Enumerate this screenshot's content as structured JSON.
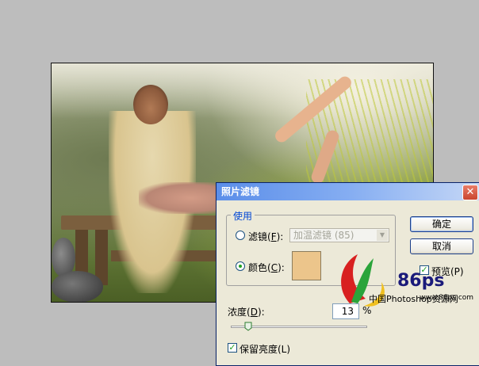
{
  "dialog": {
    "title": "照片滤镜",
    "close_glyph": "✕",
    "group_label": "使用",
    "filter_option": {
      "label": "滤镜(",
      "key": "F",
      "suffix": "):",
      "selected": false
    },
    "filter_select": {
      "value": "加温滤镜 (85)",
      "arrow_glyph": "▼"
    },
    "color_option": {
      "label": "颜色(",
      "key": "C",
      "suffix": "):",
      "selected": true
    },
    "swatch_color": "#ecc58b",
    "ok_label": "确定",
    "cancel_label": "取消",
    "preview": {
      "label": "预览(P)",
      "checked": true
    },
    "density": {
      "label": "浓度(",
      "key": "D",
      "suffix": "):",
      "value": "13",
      "unit": "%",
      "slider_fraction": 0.13
    },
    "preserve": {
      "label": "保留亮度(L)",
      "checked": true
    },
    "check_glyph": "✓"
  },
  "watermark": {
    "brand": "86ps",
    "url": "www.86ps.com",
    "tagline": "中国Photoshop资源网"
  },
  "colors": {
    "titlebar_start": "#5b8ee9",
    "dialog_bg": "#ece9d8",
    "accent_blue": "#0046d5",
    "check_green": "#21a121"
  }
}
